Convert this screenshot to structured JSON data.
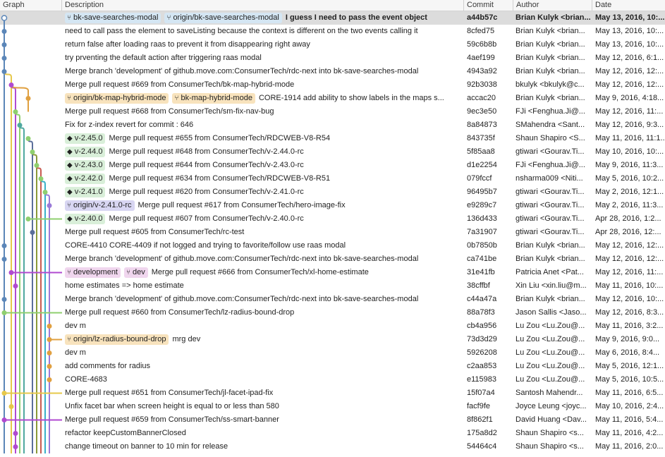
{
  "columns": {
    "graph": "Graph",
    "description": "Description",
    "commit": "Commit",
    "author": "Author",
    "date": "Date"
  },
  "rows": [
    {
      "refs": [
        {
          "type": "branch",
          "style": "branch",
          "label": "bk-save-searches-modal"
        },
        {
          "type": "branch",
          "style": "branch",
          "label": "origin/bk-save-searches-modal"
        }
      ],
      "message": "I guess I need to pass the event object",
      "commit": "a44b57c",
      "author": "Brian Kulyk <brian...",
      "date": "May 13, 2016, 10:..."
    },
    {
      "refs": [],
      "message": "need to call pass the element to saveListing because the context is different on the two events calling it",
      "commit": "8cfed75",
      "author": "Brian Kulyk <brian...",
      "date": "May 13, 2016, 10:..."
    },
    {
      "refs": [],
      "message": "return false after loading raas to prevent it from disappearing right away",
      "commit": "59c6b8b",
      "author": "Brian Kulyk <brian...",
      "date": "May 13, 2016, 10:..."
    },
    {
      "refs": [],
      "message": "try prventing the default action after triggering raas modal",
      "commit": "4aef199",
      "author": "Brian Kulyk <brian...",
      "date": "May 12, 2016, 6:1..."
    },
    {
      "refs": [],
      "message": "Merge branch 'development' of github.move.com:ConsumerTech/rdc-next into bk-save-searches-modal",
      "commit": "4943a92",
      "author": "Brian Kulyk <brian...",
      "date": "May 12, 2016, 12:..."
    },
    {
      "refs": [],
      "message": "Merge pull request #669 from ConsumerTech/bk-map-hybrid-mode",
      "commit": "92b3038",
      "author": "bkulyk <bkulyk@c...",
      "date": "May 12, 2016, 12:..."
    },
    {
      "refs": [
        {
          "type": "branch",
          "style": "orange",
          "label": "origin/bk-map-hybrid-mode"
        },
        {
          "type": "branch",
          "style": "orange",
          "label": "bk-map-hybrid-mode"
        }
      ],
      "message": "CORE-1914 add ability to show labels in the maps s...",
      "commit": "accac20",
      "author": "Brian Kulyk <brian...",
      "date": "May 9, 2016, 4:18..."
    },
    {
      "refs": [],
      "message": "Merge pull request #668 from ConsumerTech/sm-fix-nav-bug",
      "commit": "9ec3e50",
      "author": "FJi <Fenghua.Ji@...",
      "date": "May 12, 2016, 11:..."
    },
    {
      "refs": [],
      "message": "Fix for z-index revert for commit : 646",
      "commit": "8a84873",
      "author": "SMahendra <Sant...",
      "date": "May 12, 2016, 9:3..."
    },
    {
      "refs": [
        {
          "type": "tag",
          "style": "green",
          "label": "v-2.45.0"
        }
      ],
      "message": "Merge pull request #655 from ConsumerTech/RDCWEB-V8-R54",
      "commit": "843735f",
      "author": "Shaun Shapiro <S...",
      "date": "May 11, 2016, 11:1..."
    },
    {
      "refs": [
        {
          "type": "tag",
          "style": "green",
          "label": "v-2.44.0"
        }
      ],
      "message": "Merge pull request #648 from ConsumerTech/v-2.44.0-rc",
      "commit": "5f85aa8",
      "author": "gtiwari <Gourav.Ti...",
      "date": "May 10, 2016, 10:..."
    },
    {
      "refs": [
        {
          "type": "tag",
          "style": "green",
          "label": "v-2.43.0"
        }
      ],
      "message": "Merge pull request #644 from ConsumerTech/v-2.43.0-rc",
      "commit": "d1e2254",
      "author": "FJi <Fenghua.Ji@...",
      "date": "May 9, 2016, 11:3..."
    },
    {
      "refs": [
        {
          "type": "tag",
          "style": "green",
          "label": "v-2.42.0"
        }
      ],
      "message": "Merge pull request #634 from ConsumerTech/RDCWEB-V8-R51",
      "commit": "079fccf",
      "author": "nsharma009 <Niti...",
      "date": "May 5, 2016, 10:2..."
    },
    {
      "refs": [
        {
          "type": "tag",
          "style": "green",
          "label": "v-2.41.0"
        }
      ],
      "message": "Merge pull request #620 from ConsumerTech/v-2.41.0-rc",
      "commit": "96495b7",
      "author": "gtiwari <Gourav.Ti...",
      "date": "May 2, 2016, 12:1..."
    },
    {
      "refs": [
        {
          "type": "branch",
          "style": "purple",
          "label": "origin/v-2.41.0-rc"
        }
      ],
      "message": "Merge pull request #617 from ConsumerTech/hero-image-fix",
      "commit": "e9289c7",
      "author": "gtiwari <Gourav.Ti...",
      "date": "May 2, 2016, 11:3..."
    },
    {
      "refs": [
        {
          "type": "tag",
          "style": "green",
          "label": "v-2.40.0"
        }
      ],
      "message": "Merge pull request #607 from ConsumerTech/v-2.40.0-rc",
      "commit": "136d433",
      "author": "gtiwari <Gourav.Ti...",
      "date": "Apr 28, 2016, 1:2..."
    },
    {
      "refs": [],
      "message": "Merge pull request #605 from ConsumerTech/rc-test",
      "commit": "7a31907",
      "author": "gtiwari <Gourav.Ti...",
      "date": "Apr 28, 2016, 12:..."
    },
    {
      "refs": [],
      "message": "CORE-4410 CORE-4409 if not logged and trying to favorite/follow use raas modal",
      "commit": "0b7850b",
      "author": "Brian Kulyk <brian...",
      "date": "May 12, 2016, 12:..."
    },
    {
      "refs": [],
      "message": "Merge branch 'development' of github.move.com:ConsumerTech/rdc-next into bk-save-searches-modal",
      "commit": "ca741be",
      "author": "Brian Kulyk <brian...",
      "date": "May 12, 2016, 12:..."
    },
    {
      "refs": [
        {
          "type": "branch",
          "style": "pink",
          "label": "development"
        },
        {
          "type": "branch",
          "style": "pink",
          "label": "dev"
        }
      ],
      "message": "Merge pull request #666 from ConsumerTech/xl-home-estimate",
      "commit": "31e41fb",
      "author": "Patricia Anet <Pat...",
      "date": "May 12, 2016, 11:..."
    },
    {
      "refs": [],
      "message": "home estimates => home estimate",
      "commit": "38cffbf",
      "author": "Xin Liu <xin.liu@m...",
      "date": "May 11, 2016, 10:..."
    },
    {
      "refs": [],
      "message": "Merge branch 'development' of github.move.com:ConsumerTech/rdc-next into bk-save-searches-modal",
      "commit": "c44a47a",
      "author": "Brian Kulyk <brian...",
      "date": "May 12, 2016, 10:..."
    },
    {
      "refs": [],
      "message": "Merge pull request #660 from ConsumerTech/lz-radius-bound-drop",
      "commit": "88a78f3",
      "author": "Jason Sallis <Jaso...",
      "date": "May 12, 2016, 8:3..."
    },
    {
      "refs": [],
      "message": "dev m",
      "commit": "cb4a956",
      "author": "Lu Zou <Lu.Zou@...",
      "date": "May 11, 2016, 3:2..."
    },
    {
      "refs": [
        {
          "type": "branch",
          "style": "orange",
          "label": "origin/lz-radius-bound-drop"
        }
      ],
      "message": "mrg dev",
      "commit": "73d3d29",
      "author": "Lu Zou <Lu.Zou@...",
      "date": "May 9, 2016, 9:0..."
    },
    {
      "refs": [],
      "message": "dev m",
      "commit": "5926208",
      "author": "Lu Zou <Lu.Zou@...",
      "date": "May 6, 2016, 8:4..."
    },
    {
      "refs": [],
      "message": "add comments for radius",
      "commit": "c2aa853",
      "author": "Lu Zou <Lu.Zou@...",
      "date": "May 5, 2016, 12:1..."
    },
    {
      "refs": [],
      "message": "CORE-4683",
      "commit": "e115983",
      "author": "Lu Zou <Lu.Zou@...",
      "date": "May 5, 2016, 10:5..."
    },
    {
      "refs": [],
      "message": "Merge pull request #651 from ConsumerTech/jl-facet-ipad-fix",
      "commit": "15f07a4",
      "author": "Santosh Mahendr...",
      "date": "May 11, 2016, 6:5..."
    },
    {
      "refs": [],
      "message": "Unfix facet bar when screen height is equal to or less than 580",
      "commit": "facf9fe",
      "author": "Joyce Leung <joyc...",
      "date": "May 10, 2016, 2:4..."
    },
    {
      "refs": [],
      "message": "Merge pull request #659 from ConsumerTech/ss-smart-banner",
      "commit": "8f862f1",
      "author": "David Huang <Dav...",
      "date": "May 11, 2016, 5:4..."
    },
    {
      "refs": [],
      "message": "refactor keepCustomBannerClosed",
      "commit": "175a8d2",
      "author": "Shaun Shapiro <s...",
      "date": "May 11, 2016, 4:2..."
    },
    {
      "refs": [],
      "message": "change timeout on banner to 10 min for release",
      "commit": "54464c4",
      "author": "Shaun Shapiro <s...",
      "date": "May 11, 2016, 2:0..."
    }
  ],
  "colors": {
    "selected_row": "#dcdcdc",
    "header_bg": "#f6f6f6",
    "lane_blue": "#5b86b8",
    "lane_yellow": "#e6c84a",
    "lane_purple": "#b04ad0",
    "lane_lightgreen": "#8fcf6f",
    "lane_teal": "#4fa8a0",
    "lane_slate": "#5a6e9a",
    "lane_red": "#c85a50",
    "lane_olive": "#8a9a3a",
    "lane_cyan": "#3ab0c8",
    "lane_lavender": "#9a7ad8"
  },
  "icons": {
    "branch": "branch-icon",
    "tag": "tag-icon"
  }
}
